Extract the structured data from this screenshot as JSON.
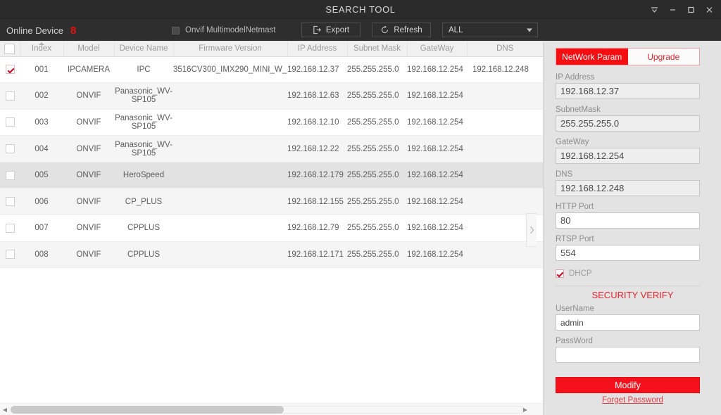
{
  "window": {
    "title": "SEARCH TOOL",
    "controls": [
      {
        "name": "tray-icon",
        "glyph": "▼"
      },
      {
        "name": "minimize-icon",
        "glyph": "—"
      },
      {
        "name": "maximize-icon",
        "glyph": "▢"
      },
      {
        "name": "close-icon",
        "glyph": "✕"
      }
    ]
  },
  "toolbar": {
    "online_device_label": "Online Device",
    "online_device_count": "8",
    "onvif_checkbox_label": "Onvif MultimodelNetmast",
    "export_label": "Export",
    "refresh_label": "Refresh",
    "filter_selected": "ALL",
    "filter_options": [
      "ALL"
    ]
  },
  "table": {
    "columns": [
      "Index",
      "Model",
      "Device Name",
      "Firmware Version",
      "IP Address",
      "Subnet Mask",
      "GateWay",
      "DNS"
    ],
    "sort_column": "Index",
    "sort_direction": "asc",
    "rows": [
      {
        "checked": true,
        "state": "selected",
        "index": "001",
        "model": "IPCAMERA",
        "device_name": "IPC",
        "firmware": "3516CV300_IMX290_MINI_W_...",
        "ip": "192.168.12.37",
        "mask": "255.255.255.0",
        "gateway": "192.168.12.254",
        "dns": "192.168.12.248"
      },
      {
        "checked": false,
        "state": "alt",
        "index": "002",
        "model": "ONVIF",
        "device_name": "Panasonic_WV-SP105",
        "firmware": "",
        "ip": "192.168.12.63",
        "mask": "255.255.255.0",
        "gateway": "192.168.12.254",
        "dns": ""
      },
      {
        "checked": false,
        "state": "normal",
        "index": "003",
        "model": "ONVIF",
        "device_name": "Panasonic_WV-SP105",
        "firmware": "",
        "ip": "192.168.12.10",
        "mask": "255.255.255.0",
        "gateway": "192.168.12.254",
        "dns": ""
      },
      {
        "checked": false,
        "state": "alt",
        "index": "004",
        "model": "ONVIF",
        "device_name": "Panasonic_WV-SP105",
        "firmware": "",
        "ip": "192.168.12.22",
        "mask": "255.255.255.0",
        "gateway": "192.168.12.254",
        "dns": ""
      },
      {
        "checked": false,
        "state": "hover",
        "index": "005",
        "model": "ONVIF",
        "device_name": "HeroSpeed",
        "firmware": "",
        "ip": "192.168.12.179",
        "mask": "255.255.255.0",
        "gateway": "192.168.12.254",
        "dns": ""
      },
      {
        "checked": false,
        "state": "alt",
        "index": "006",
        "model": "ONVIF",
        "device_name": "CP_PLUS",
        "firmware": "",
        "ip": "192.168.12.155",
        "mask": "255.255.255.0",
        "gateway": "192.168.12.254",
        "dns": ""
      },
      {
        "checked": false,
        "state": "normal",
        "index": "007",
        "model": "ONVIF",
        "device_name": "CPPLUS",
        "firmware": "",
        "ip": "192.168.12.79",
        "mask": "255.255.255.0",
        "gateway": "192.168.12.254",
        "dns": ""
      },
      {
        "checked": false,
        "state": "alt",
        "index": "008",
        "model": "ONVIF",
        "device_name": "CPPLUS",
        "firmware": "",
        "ip": "192.168.12.171",
        "mask": "255.255.255.0",
        "gateway": "192.168.12.254",
        "dns": ""
      }
    ]
  },
  "panel": {
    "tabs": [
      {
        "label": "NetWork Param",
        "active": true
      },
      {
        "label": "Upgrade",
        "active": false
      }
    ],
    "fields": [
      {
        "label": "IP Address",
        "value": "192.168.12.37",
        "style": "grayed"
      },
      {
        "label": "SubnetMask",
        "value": "255.255.255.0",
        "style": "grayed"
      },
      {
        "label": "GateWay",
        "value": "192.168.12.254",
        "style": "grayed"
      },
      {
        "label": "DNS",
        "value": "192.168.12.248",
        "style": "grayed"
      },
      {
        "label": "HTTP Port",
        "value": "80",
        "style": "normal"
      },
      {
        "label": "RTSP Port",
        "value": "554",
        "style": "normal"
      }
    ],
    "dhcp": {
      "label": "DHCP",
      "checked": true
    },
    "security_title": "SECURITY VERIFY",
    "username": {
      "label": "UserName",
      "value": "admin",
      "placeholder": ""
    },
    "password": {
      "label": "PassWord",
      "value": "",
      "placeholder": ""
    },
    "modify_label": "Modify",
    "forget_password_label": "Forget Password"
  },
  "scrollbar": {
    "left_arrow": "◀",
    "right_arrow": "▶"
  },
  "colors": {
    "accent_red": "#f4111b",
    "title_bar": "#2b2b2b",
    "toolbar": "#2e2e2e",
    "panel_bg": "#e3e3e3",
    "count_red": "#e81010"
  }
}
